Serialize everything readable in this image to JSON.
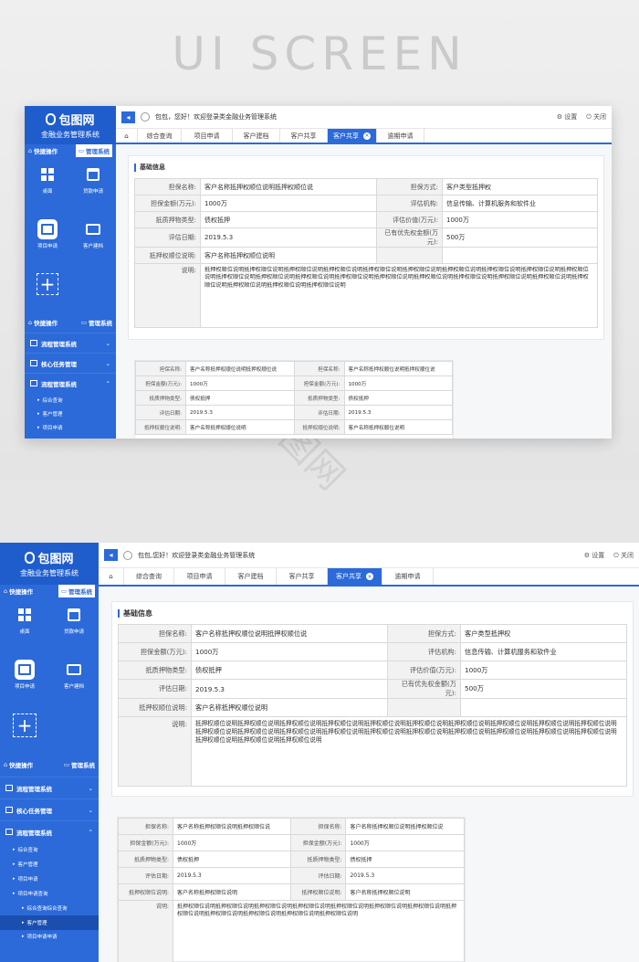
{
  "hero": {
    "title": "UI SCREEN",
    "watermark": "包图网"
  },
  "brand": {
    "name": "包图网",
    "subtitle": "金融业务管理系统"
  },
  "quick": {
    "left": "快捷操作",
    "right": "管理系统"
  },
  "tiles": [
    {
      "label": "桌面",
      "icon": "desktop-icon"
    },
    {
      "label": "贷款申请",
      "icon": "calendar-icon"
    },
    {
      "label": "项目申请",
      "icon": "document-icon"
    },
    {
      "label": "客户建档",
      "icon": "id-card-icon"
    }
  ],
  "menu": [
    {
      "label": "流程管理系统"
    },
    {
      "label": "核心任务管理"
    },
    {
      "label": "流程管理系统"
    }
  ],
  "submenu1": [
    "综合查询",
    "客户管理",
    "项目申请"
  ],
  "submenu2": [
    "综合查询",
    "客户管理",
    "项目申请",
    "项目申请查询",
    "综合查询综合查询",
    "客户管理",
    "项目申请申请"
  ],
  "topbar": {
    "greeting1": "包包，您好！欢迎登录类金融业务管理系统",
    "greeting2": "包包,您好！欢迎登录类金融业务管理系统",
    "settings": "设置",
    "close": "关闭"
  },
  "tabs": [
    "综合查询",
    "项目申请",
    "客户建档",
    "客户共享",
    "客户共享",
    "逾期申请"
  ],
  "section": {
    "title": "基础信息"
  },
  "form": {
    "guarantee_name_label": "担保名称:",
    "guarantee_name": "客户名称抵押权顺位说明抵押权顺位说",
    "guarantee_mode_label": "担保方式:",
    "guarantee_mode": "客户类型抵押权",
    "amount_label": "担保金额(万元):",
    "amount": "1000万",
    "agency_label": "评估机构:",
    "agency": "信息传输、计算机服务和软件业",
    "collateral_label": "抵质押物类型:",
    "collateral": "债权抵押",
    "value_label": "评估价值(万元):",
    "value": "1000万",
    "date_label": "评估日期:",
    "date": "2019.5.3",
    "prior_label": "已有优先权金额(万元):",
    "prior": "500万",
    "order_label": "抵押权顺位说明:",
    "order": "客户名称抵押权顺位说明",
    "desc_label": "说明:",
    "desc": "抵押权顺位说明抵押权顺位说明抵押权顺位说明抵押权顺位说明抵押权顺位说明抵押权顺位说明抵押权顺位说明抵押权顺位说明抵押权顺位说明抵押权顺位说明抵押权顺位说明抵押权顺位说明抵押权顺位说明抵押权顺位说明抵押权顺位说明抵押权顺位说明抵押权顺位说明抵押权顺位说明抵押权顺位说明抵押权顺位说明抵押权顺位说明抵押权顺位说明抵押权顺位说明"
  },
  "form2": {
    "name_a": "客户名称抵押权顺位说明抵押权顺位说",
    "name_b": "客户名称抵押权顺位说明抵押权顺位说",
    "amount_a": "1000万",
    "amount_b": "1000万",
    "coll_a": "债权抵押",
    "coll_b": "债权抵押",
    "date_a": "2019.5.3",
    "date_b": "2019.5.3",
    "order_a": "客户名称抵押权顺位说明",
    "order_b": "客户名称抵押权顺位说明",
    "desc": "抵押权顺位说明抵押权顺位说明抵押权顺位说明抵押权顺位说明抵押权顺位说明抵押权顺位说明抵押权顺位说明抵押权顺位说明抵押权顺位说明抵押权顺位说明抵押权顺位说明抵押权顺位说明"
  },
  "colors": {
    "primary": "#2b6ad8",
    "sidebar_dark": "#1f5dcc"
  }
}
